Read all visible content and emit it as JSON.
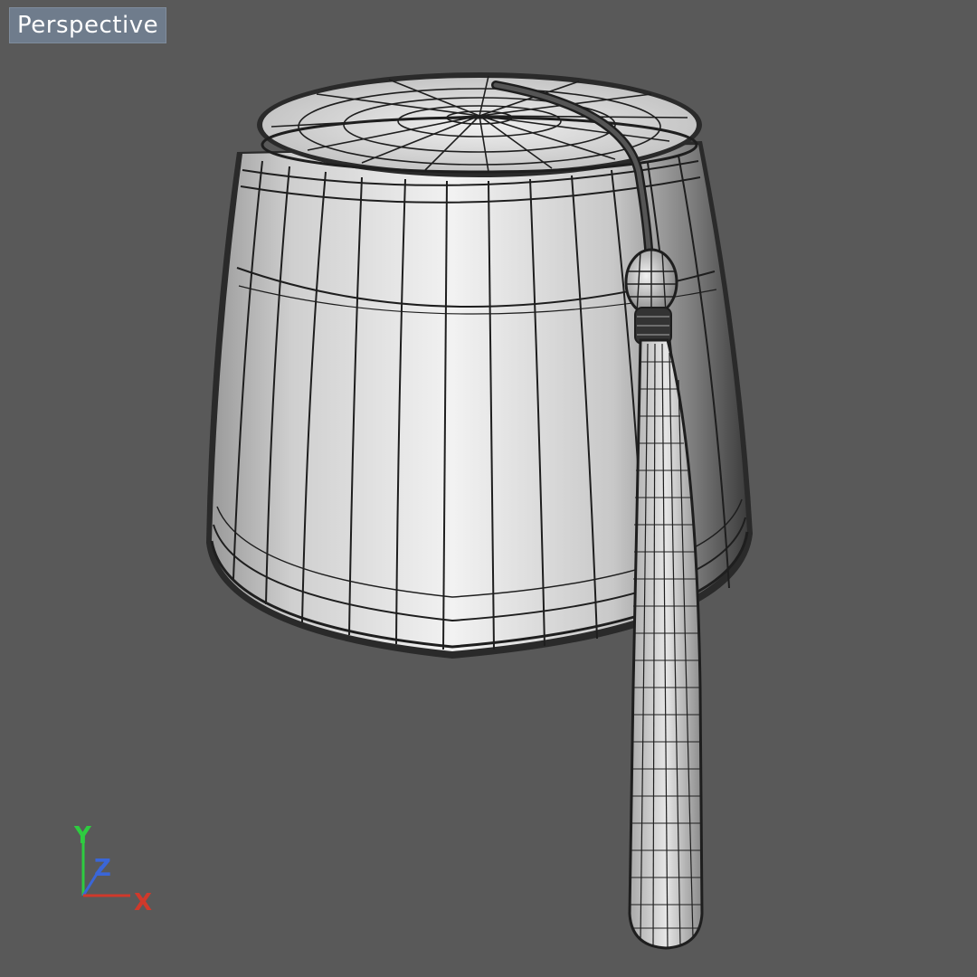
{
  "viewport": {
    "label": "Perspective",
    "background": "#595959"
  },
  "model": {
    "name": "fez-icon",
    "display_mode": "wireframe-on-shaded",
    "surface_color": "#d9d9d9",
    "wire_color": "#1e1e1e"
  },
  "axis_gizmo": {
    "x_label": "X",
    "y_label": "Y",
    "z_label": "Z",
    "x_color": "#d0392b",
    "y_color": "#2ecc40",
    "z_color": "#3a66d8"
  }
}
